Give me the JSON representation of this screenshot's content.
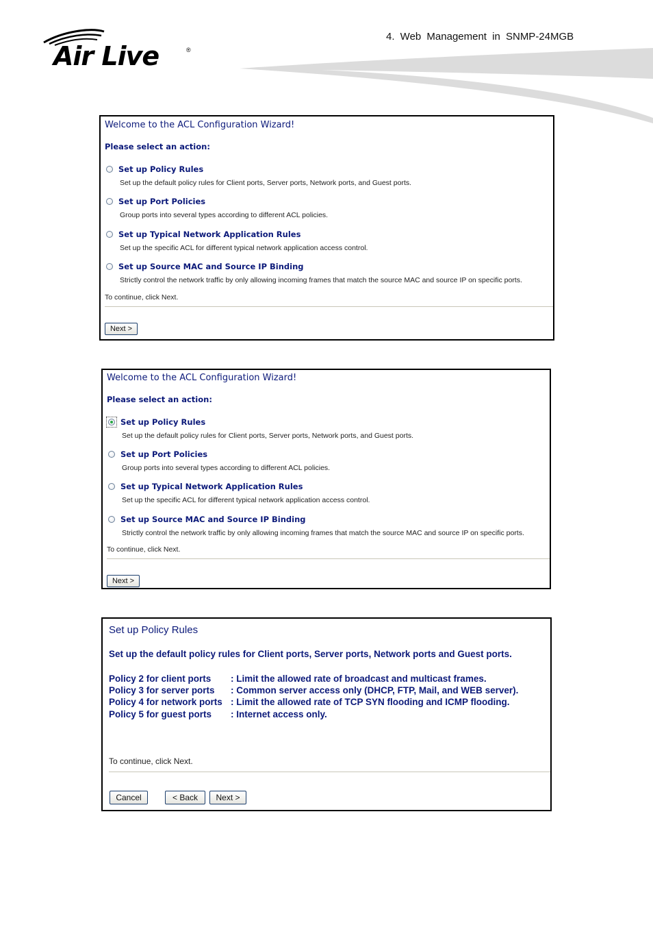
{
  "header": {
    "logo_text": "Air Live",
    "logo_registered": "®",
    "section_title": "4.   Web Management in SNMP-24MGB"
  },
  "wizard_unselected": {
    "title": "Welcome to the ACL Configuration Wizard!",
    "prompt": "Please select an action:",
    "options": [
      {
        "label": "Set up Policy Rules",
        "description": "Set up the default policy rules for Client ports, Server ports, Network ports, and Guest ports.",
        "selected": false
      },
      {
        "label": "Set up Port Policies",
        "description": "Group ports into several types according to different ACL policies.",
        "selected": false
      },
      {
        "label": "Set up Typical Network Application Rules",
        "description": "Set up the specific ACL for different typical network application access control.",
        "selected": false
      },
      {
        "label": "Set up Source MAC and Source IP Binding",
        "description": "Strictly control the network traffic by only allowing incoming frames that match the source MAC and source IP on specific ports.",
        "selected": false
      }
    ],
    "continue_text": "To continue, click Next.",
    "next_label": "Next >"
  },
  "wizard_selected": {
    "title": "Welcome to the ACL Configuration Wizard!",
    "prompt": "Please select an action:",
    "options": [
      {
        "label": "Set up Policy Rules",
        "description": "Set up the default policy rules for Client ports, Server ports, Network ports, and Guest ports.",
        "selected": true
      },
      {
        "label": "Set up Port Policies",
        "description": "Group ports into several types according to different ACL policies.",
        "selected": false
      },
      {
        "label": "Set up Typical Network Application Rules",
        "description": "Set up the specific ACL for different typical network application access control.",
        "selected": false
      },
      {
        "label": "Set up Source MAC and Source IP Binding",
        "description": "Strictly control the network traffic by only allowing incoming frames that match the source MAC and source IP on specific ports.",
        "selected": false
      }
    ],
    "continue_text": "To continue, click Next.",
    "next_label": "Next >"
  },
  "policy_rules": {
    "title": "Set up Policy Rules",
    "subtitle": "Set up the default policy rules for Client ports, Server ports, Network ports and Guest ports.",
    "policies": [
      {
        "name": "Policy 2 for client ports",
        "description": ": Limit the allowed rate of broadcast and multicast frames."
      },
      {
        "name": "Policy 3 for server ports",
        "description": ": Common server access only (DHCP, FTP, Mail, and WEB server)."
      },
      {
        "name": "Policy 4 for network ports",
        "description": ": Limit the allowed rate of TCP SYN flooding and ICMP flooding."
      },
      {
        "name": "Policy 5 for guest ports",
        "description": ": Internet access only."
      }
    ],
    "continue_text": "To continue, click Next.",
    "cancel_label": "Cancel",
    "back_label": "< Back",
    "next_label": "Next >"
  },
  "colors": {
    "wizard_text": "#0c1a7a",
    "panel_border": "#000000",
    "swoosh": "#dcdcdc"
  }
}
